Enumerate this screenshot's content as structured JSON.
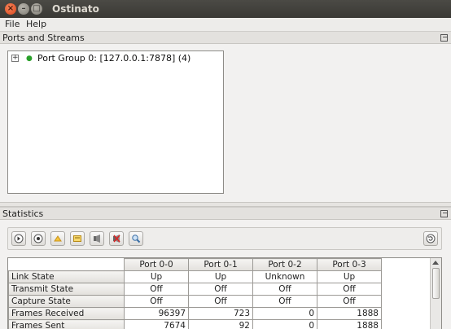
{
  "window": {
    "title": "Ostinato",
    "close_glyph": "×",
    "min_glyph": "–",
    "max_glyph": "□"
  },
  "menu": [
    {
      "label": "File"
    },
    {
      "label": "Help"
    }
  ],
  "ports_panel": {
    "title": "Ports and Streams",
    "tree": [
      {
        "expander": "+",
        "label": "Port Group 0:  [127.0.0.1:7878] (4)",
        "status_color": "#2aa02a"
      }
    ]
  },
  "stats_panel": {
    "title": "Statistics",
    "toolbar_icons": [
      "start-icon",
      "stop-icon",
      "clear-icon",
      "clear-selected-icon",
      "start-capture-icon",
      "stop-capture-icon",
      "view-capture-icon"
    ],
    "columns": [
      "Port 0-0",
      "Port 0-1",
      "Port 0-2",
      "Port 0-3"
    ],
    "rows": [
      {
        "label": "Link State",
        "align": "c",
        "values": [
          "Up",
          "Up",
          "Unknown",
          "Up"
        ]
      },
      {
        "label": "Transmit State",
        "align": "c",
        "values": [
          "Off",
          "Off",
          "Off",
          "Off"
        ]
      },
      {
        "label": "Capture State",
        "align": "c",
        "values": [
          "Off",
          "Off",
          "Off",
          "Off"
        ]
      },
      {
        "label": "Frames Received",
        "align": "r",
        "values": [
          "96397",
          "723",
          "0",
          "1888"
        ]
      },
      {
        "label": "Frames Sent",
        "align": "r",
        "values": [
          "7674",
          "92",
          "0",
          "1888"
        ]
      }
    ]
  }
}
